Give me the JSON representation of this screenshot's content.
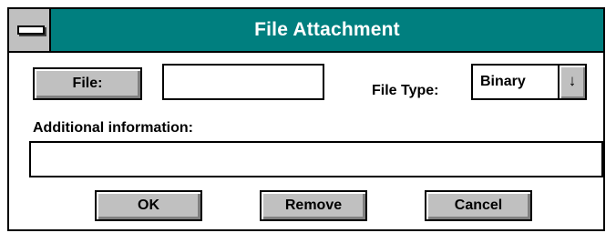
{
  "window": {
    "title": "File Attachment"
  },
  "file_button": {
    "label": "File:"
  },
  "file_input": {
    "value": ""
  },
  "file_type": {
    "label": "File Type:",
    "selected": "Binary",
    "arrow": "↓"
  },
  "additional_info": {
    "label": "Additional information:",
    "value": ""
  },
  "buttons": {
    "ok": "OK",
    "remove": "Remove",
    "cancel": "Cancel"
  },
  "colors": {
    "titlebar": "#007f7f",
    "button_face": "#c0c0c0"
  }
}
